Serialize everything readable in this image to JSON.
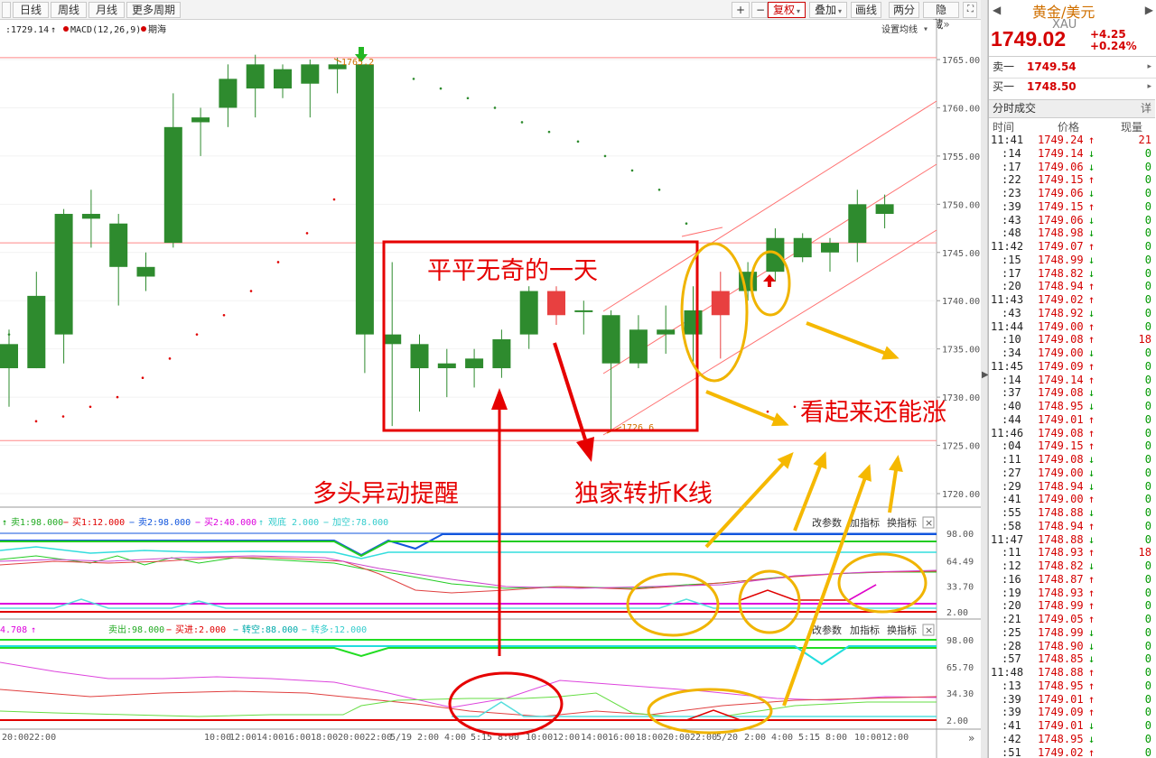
{
  "toolbar": {
    "left_tabs": [
      "日线",
      "周线",
      "月线",
      "更多周期"
    ],
    "right_buttons": [
      "+",
      "−",
      "复权",
      "叠加",
      "画线",
      "两分",
      "隐藏"
    ],
    "more_arrow": "»"
  },
  "chart": {
    "legend_price": ":1729.14",
    "legend_macd": "MACD(12,26,9)",
    "legend_period": "期海",
    "setting_label": "设置均线",
    "price_axis": [
      "1765.00",
      "1760.00",
      "1755.00",
      "1750.00",
      "1745.00",
      "1740.00",
      "1735.00",
      "1730.00",
      "1725.00",
      "1720.00"
    ],
    "high_label": "1765.2",
    "low_label": "1726.6",
    "sub1_legend": [
      "卖1:98.000",
      "买1:12.000",
      "卖2:98.000",
      "买2:40.000",
      "观底 2.000",
      "加空:78.000"
    ],
    "sub1_axis": [
      "98.00",
      "64.49",
      "33.70",
      "2.00"
    ],
    "sub2_legend_left": "4.708",
    "sub2_legend": [
      "卖出:98.000",
      "买进:2.000",
      "转空:88.000",
      "转多:12.000"
    ],
    "sub2_axis": [
      "98.00",
      "65.70",
      "34.30",
      "2.00"
    ],
    "sub_buttons": [
      "改参数",
      "加指标",
      "换指标"
    ],
    "close_symbol": "×",
    "time_axis": [
      "20:00",
      "22:00",
      "10:00",
      "12:00",
      "14:00",
      "16:00",
      "18:00",
      "20:00",
      "22:00",
      "5/19",
      "2:00",
      "4:00",
      "5:15",
      "8:00",
      "10:00",
      "12:00",
      "14:00",
      "16:00",
      "18:00",
      "20:00",
      "22:00",
      "5/20",
      "2:00",
      "4:00",
      "5:15",
      "8:00",
      "10:00",
      "12:00"
    ]
  },
  "annotations": {
    "box_text": "平平无奇的一天",
    "alert_text": "多头异动提醒",
    "kline_text": "独家转折K线",
    "rise_text": "看起来还能涨"
  },
  "chart_data": {
    "type": "candlestick",
    "title": "黄金/美元",
    "ylim": [
      1718,
      1767
    ],
    "candles": [
      {
        "o": 1733.0,
        "c": 1735.5,
        "h": 1737.0,
        "l": 1729.0
      },
      {
        "o": 1733.0,
        "c": 1740.5,
        "h": 1743.0,
        "l": 1733.0
      },
      {
        "o": 1736.5,
        "c": 1749.0,
        "h": 1749.5,
        "l": 1733.5
      },
      {
        "o": 1748.5,
        "c": 1749.0,
        "h": 1751.5,
        "l": 1745.5
      },
      {
        "o": 1748.0,
        "c": 1743.5,
        "h": 1749.0,
        "l": 1739.5
      },
      {
        "o": 1742.5,
        "c": 1743.5,
        "h": 1745.0,
        "l": 1741.0
      },
      {
        "o": 1746.0,
        "c": 1758.0,
        "h": 1761.5,
        "l": 1745.5
      },
      {
        "o": 1758.5,
        "c": 1759.0,
        "h": 1760.0,
        "l": 1755.0
      },
      {
        "o": 1760.0,
        "c": 1763.0,
        "h": 1764.5,
        "l": 1758.0
      },
      {
        "o": 1762.0,
        "c": 1764.5,
        "h": 1765.5,
        "l": 1759.0
      },
      {
        "o": 1762.0,
        "c": 1764.0,
        "h": 1764.5,
        "l": 1761.0
      },
      {
        "o": 1762.5,
        "c": 1764.5,
        "h": 1765.0,
        "l": 1759.0
      },
      {
        "o": 1764.0,
        "c": 1764.5,
        "h": 1765.2,
        "l": 1761.5
      },
      {
        "o": 1764.5,
        "c": 1736.5,
        "h": 1764.5,
        "l": 1732.5
      },
      {
        "o": 1736.5,
        "c": 1735.5,
        "h": 1744.0,
        "l": 1727.0
      },
      {
        "o": 1735.5,
        "c": 1733.0,
        "h": 1736.5,
        "l": 1728.5
      },
      {
        "o": 1733.0,
        "c": 1733.5,
        "h": 1735.0,
        "l": 1730.0
      },
      {
        "o": 1733.0,
        "c": 1734.0,
        "h": 1735.0,
        "l": 1731.0
      },
      {
        "o": 1733.0,
        "c": 1736.0,
        "h": 1737.0,
        "l": 1732.0
      },
      {
        "o": 1736.5,
        "c": 1741.0,
        "h": 1741.5,
        "l": 1735.0
      },
      {
        "o": 1741.0,
        "c": 1738.5,
        "h": 1741.5,
        "l": 1737.5
      },
      {
        "o": 1739.0,
        "c": 1739.0,
        "h": 1740.0,
        "l": 1736.5
      },
      {
        "o": 1738.5,
        "c": 1733.5,
        "h": 1739.0,
        "l": 1726.6
      },
      {
        "o": 1733.5,
        "c": 1737.0,
        "h": 1738.5,
        "l": 1733.0
      },
      {
        "o": 1736.5,
        "c": 1737.0,
        "h": 1739.5,
        "l": 1734.5
      },
      {
        "o": 1736.5,
        "c": 1739.0,
        "h": 1741.5,
        "l": 1733.5
      },
      {
        "o": 1738.5,
        "c": 1741.0,
        "h": 1743.0,
        "l": 1734.0
      },
      {
        "o": 1741.0,
        "c": 1743.0,
        "h": 1744.0,
        "l": 1740.0
      },
      {
        "o": 1743.0,
        "c": 1746.5,
        "h": 1747.5,
        "l": 1742.0
      },
      {
        "o": 1744.5,
        "c": 1746.5,
        "h": 1747.0,
        "l": 1744.0
      },
      {
        "o": 1745.0,
        "c": 1746.0,
        "h": 1746.5,
        "l": 1743.0
      },
      {
        "o": 1746.0,
        "c": 1750.0,
        "h": 1751.5,
        "l": 1744.0
      },
      {
        "o": 1749.0,
        "c": 1750.0,
        "h": 1751.0,
        "l": 1747.5
      }
    ],
    "reference_lines": [
      1765.2,
      1746.0,
      1725.5
    ]
  },
  "quote": {
    "name": "黄金/美元",
    "code": "XAU",
    "price": "1749.02",
    "change": "+4.25",
    "change_pct": "+0.24%",
    "sell_label": "卖一",
    "sell_price": "1749.54",
    "buy_label": "买一",
    "buy_price": "1748.50",
    "section_title": "分时成交",
    "section_btn": "详",
    "col_time": "时间",
    "col_price": "价格",
    "col_vol": "现量",
    "nav_left": "◀",
    "nav_right": "▶"
  },
  "trades": [
    {
      "t": "11:41",
      "p": "1749.24",
      "d": "up",
      "v": "21"
    },
    {
      "t": ":14",
      "p": "1749.14",
      "d": "dn",
      "v": "0"
    },
    {
      "t": ":17",
      "p": "1749.06",
      "d": "dn",
      "v": "0"
    },
    {
      "t": ":22",
      "p": "1749.15",
      "d": "up",
      "v": "0"
    },
    {
      "t": ":23",
      "p": "1749.06",
      "d": "dn",
      "v": "0"
    },
    {
      "t": ":39",
      "p": "1749.15",
      "d": "up",
      "v": "0"
    },
    {
      "t": ":43",
      "p": "1749.06",
      "d": "dn",
      "v": "0"
    },
    {
      "t": ":48",
      "p": "1748.98",
      "d": "dn",
      "v": "0"
    },
    {
      "t": "11:42",
      "p": "1749.07",
      "d": "up",
      "v": "0"
    },
    {
      "t": ":15",
      "p": "1748.99",
      "d": "dn",
      "v": "0"
    },
    {
      "t": ":17",
      "p": "1748.82",
      "d": "dn",
      "v": "0"
    },
    {
      "t": ":20",
      "p": "1748.94",
      "d": "up",
      "v": "0"
    },
    {
      "t": "11:43",
      "p": "1749.02",
      "d": "up",
      "v": "0"
    },
    {
      "t": ":43",
      "p": "1748.92",
      "d": "dn",
      "v": "0"
    },
    {
      "t": "11:44",
      "p": "1749.00",
      "d": "up",
      "v": "0"
    },
    {
      "t": ":10",
      "p": "1749.08",
      "d": "up",
      "v": "18"
    },
    {
      "t": ":34",
      "p": "1749.00",
      "d": "dn",
      "v": "0"
    },
    {
      "t": "11:45",
      "p": "1749.09",
      "d": "up",
      "v": "0"
    },
    {
      "t": ":14",
      "p": "1749.14",
      "d": "up",
      "v": "0"
    },
    {
      "t": ":37",
      "p": "1749.08",
      "d": "dn",
      "v": "0"
    },
    {
      "t": ":40",
      "p": "1748.95",
      "d": "dn",
      "v": "0"
    },
    {
      "t": ":44",
      "p": "1749.01",
      "d": "up",
      "v": "0"
    },
    {
      "t": "11:46",
      "p": "1749.08",
      "d": "up",
      "v": "0"
    },
    {
      "t": ":04",
      "p": "1749.15",
      "d": "up",
      "v": "0"
    },
    {
      "t": ":11",
      "p": "1749.08",
      "d": "dn",
      "v": "0"
    },
    {
      "t": ":27",
      "p": "1749.00",
      "d": "dn",
      "v": "0"
    },
    {
      "t": ":29",
      "p": "1748.94",
      "d": "dn",
      "v": "0"
    },
    {
      "t": ":41",
      "p": "1749.00",
      "d": "up",
      "v": "0"
    },
    {
      "t": ":55",
      "p": "1748.88",
      "d": "dn",
      "v": "0"
    },
    {
      "t": ":58",
      "p": "1748.94",
      "d": "up",
      "v": "0"
    },
    {
      "t": "11:47",
      "p": "1748.88",
      "d": "dn",
      "v": "0"
    },
    {
      "t": ":11",
      "p": "1748.93",
      "d": "up",
      "v": "18"
    },
    {
      "t": ":12",
      "p": "1748.82",
      "d": "dn",
      "v": "0"
    },
    {
      "t": ":16",
      "p": "1748.87",
      "d": "up",
      "v": "0"
    },
    {
      "t": ":19",
      "p": "1748.93",
      "d": "up",
      "v": "0"
    },
    {
      "t": ":20",
      "p": "1748.99",
      "d": "up",
      "v": "0"
    },
    {
      "t": ":21",
      "p": "1749.05",
      "d": "up",
      "v": "0"
    },
    {
      "t": ":25",
      "p": "1748.99",
      "d": "dn",
      "v": "0"
    },
    {
      "t": ":28",
      "p": "1748.90",
      "d": "dn",
      "v": "0"
    },
    {
      "t": ":57",
      "p": "1748.85",
      "d": "dn",
      "v": "0"
    },
    {
      "t": "11:48",
      "p": "1748.88",
      "d": "up",
      "v": "0"
    },
    {
      "t": ":13",
      "p": "1748.95",
      "d": "up",
      "v": "0"
    },
    {
      "t": ":39",
      "p": "1749.01",
      "d": "up",
      "v": "0"
    },
    {
      "t": ":39",
      "p": "1749.09",
      "d": "up",
      "v": "0"
    },
    {
      "t": ":41",
      "p": "1749.01",
      "d": "dn",
      "v": "0"
    },
    {
      "t": ":42",
      "p": "1748.95",
      "d": "dn",
      "v": "0"
    },
    {
      "t": ":51",
      "p": "1749.02",
      "d": "up",
      "v": "0"
    }
  ]
}
